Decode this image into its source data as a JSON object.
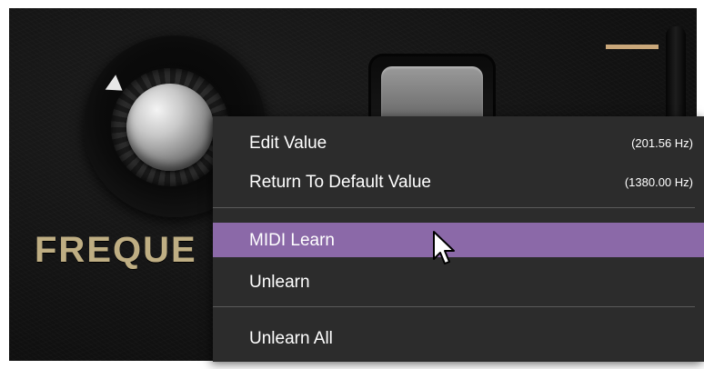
{
  "plugin": {
    "knob_label": "FREQUE",
    "accent_color": "#bfae83"
  },
  "context_menu": {
    "items": [
      {
        "label": "Edit Value",
        "value": "(201.56 Hz)"
      },
      {
        "label": "Return To Default Value",
        "value": "(1380.00 Hz)"
      },
      {
        "label": "MIDI Learn",
        "value": ""
      },
      {
        "label": "Unlearn",
        "value": ""
      },
      {
        "label": "Unlearn All",
        "value": ""
      }
    ],
    "highlight_color": "#8b69a8",
    "highlighted_item": "MIDI Learn"
  },
  "icons": {
    "cursor": "mouse-pointer-icon",
    "knob_pointer": "triangle-pointer-icon"
  }
}
